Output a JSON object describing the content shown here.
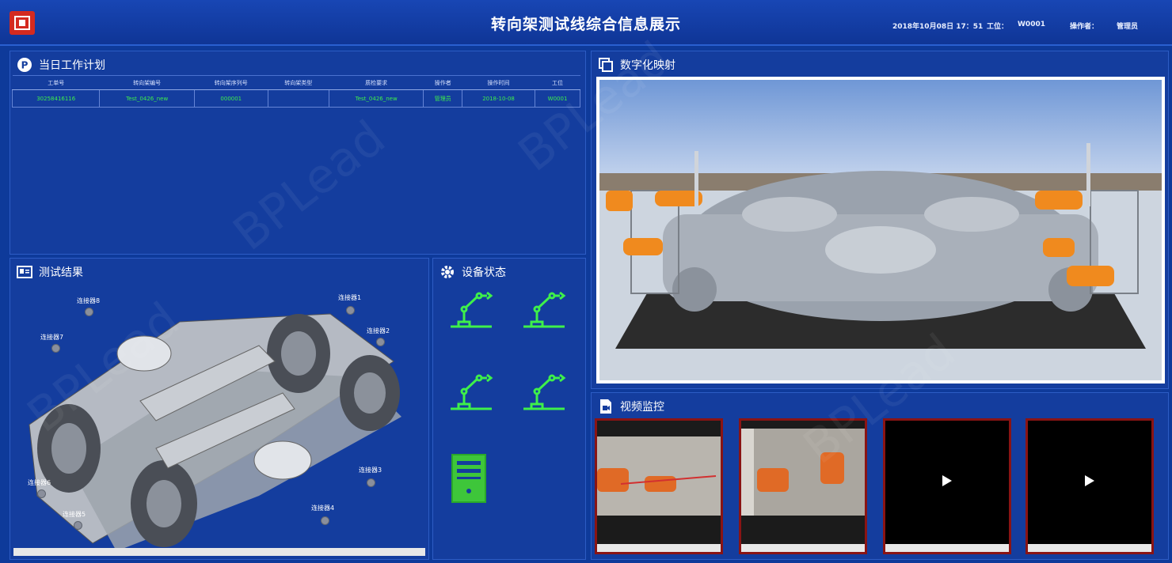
{
  "header": {
    "title": "转向架测试线综合信息展示",
    "datetime": "2018年10月08日 17：51",
    "station_label": "工位：",
    "station_value": "W0001",
    "operator_label": "操作者：",
    "operator_value": "管理员"
  },
  "plan": {
    "title": "当日工作计划",
    "columns": [
      "工单号",
      "转向架编号",
      "转向架序列号",
      "转向架类型",
      "质检要求",
      "操作者",
      "操作时间",
      "工位"
    ],
    "rows": [
      [
        "30258416116",
        "Test_0426_new",
        "000001",
        "",
        "Test_0426_new",
        "管理员",
        "2018-10-08",
        "W0001"
      ]
    ]
  },
  "digital": {
    "title": "数字化映射"
  },
  "results": {
    "title": "测试结果",
    "connectors": [
      "连接器1",
      "连接器2",
      "连接器3",
      "连接器4",
      "连接器5",
      "连接器6",
      "连接器7",
      "连接器8"
    ]
  },
  "devices": {
    "title": "设备状态"
  },
  "video": {
    "title": "视频监控"
  },
  "colors": {
    "accent": "#3ef04a",
    "panel": "#143d9e",
    "bg": "#0e3a9a",
    "robot_orange": "#f08a1e"
  },
  "watermark": "BPLead"
}
